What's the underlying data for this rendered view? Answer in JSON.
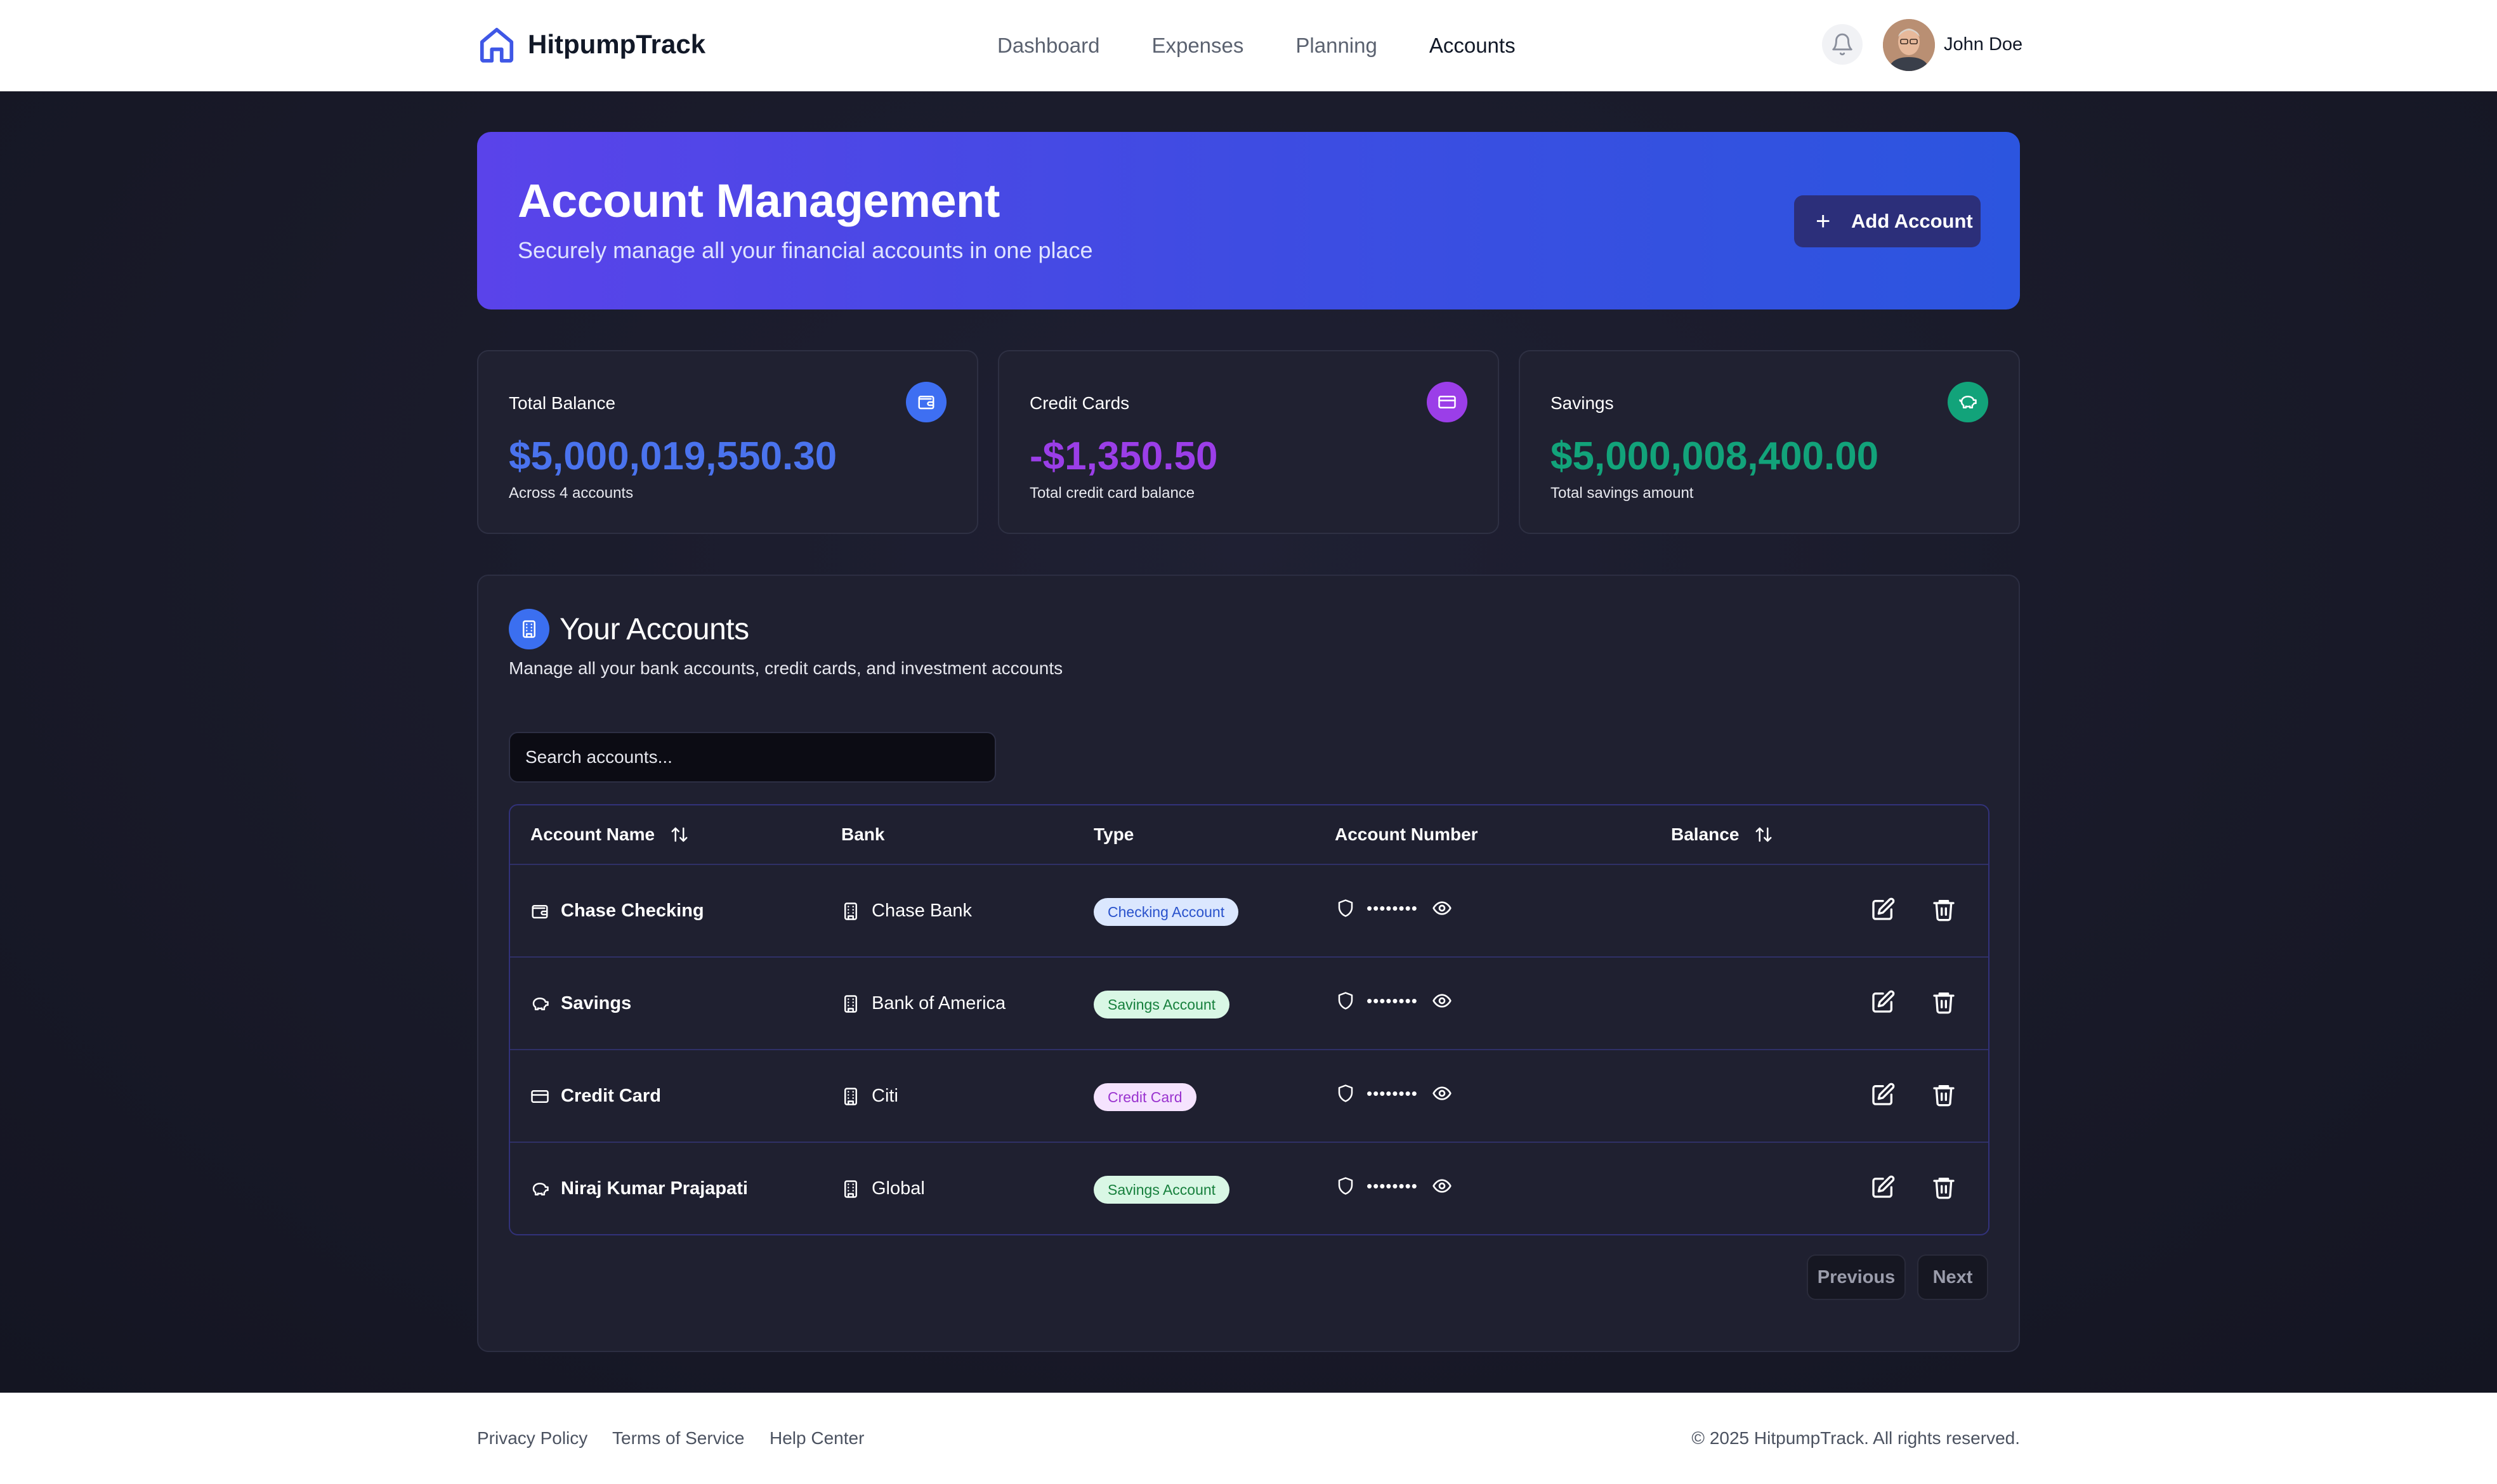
{
  "app": {
    "name": "HitpumpTrack"
  },
  "nav": [
    {
      "label": "Dashboard",
      "active": false
    },
    {
      "label": "Expenses",
      "active": false
    },
    {
      "label": "Planning",
      "active": false
    },
    {
      "label": "Accounts",
      "active": true
    }
  ],
  "user": {
    "name": "John Doe",
    "avatar_icon": "user-avatar"
  },
  "hero": {
    "title": "Account Management",
    "subtitle": "Securely manage all your financial accounts in one place",
    "add_button": "Add Account"
  },
  "stats": {
    "total_balance": {
      "title": "Total Balance",
      "value": "$5,000,019,550.30",
      "sub": "Across 4 accounts",
      "icon": "wallet-icon",
      "color": "#3e6ff2"
    },
    "credit_cards": {
      "title": "Credit Cards",
      "value": "-$1,350.50",
      "sub": "Total credit card balance",
      "icon": "credit-card-icon",
      "color": "#9b3ee8"
    },
    "savings": {
      "title": "Savings",
      "value": "$5,000,008,400.00",
      "sub": "Total savings amount",
      "icon": "piggy-bank-icon",
      "color": "#12a37a"
    }
  },
  "accounts_panel": {
    "title": "Your Accounts",
    "description": "Manage all your bank accounts, credit cards, and investment accounts",
    "search_placeholder": "Search accounts...",
    "columns": [
      "Account Name",
      "Bank",
      "Type",
      "Account Number",
      "Balance"
    ],
    "rows": [
      {
        "name": "Chase Checking",
        "bank": "Chase Bank",
        "type": "Checking Account",
        "type_kind": "checking",
        "account_number": "••••••••",
        "balance": ""
      },
      {
        "name": "Savings",
        "bank": "Bank of America",
        "type": "Savings Account",
        "type_kind": "savings",
        "account_number": "••••••••",
        "balance": ""
      },
      {
        "name": "Credit Card",
        "bank": "Citi",
        "type": "Credit Card",
        "type_kind": "credit",
        "account_number": "••••••••",
        "balance": ""
      },
      {
        "name": "Niraj Kumar Prajapati",
        "bank": "Global",
        "type": "Savings Account",
        "type_kind": "savings",
        "account_number": "••••••••",
        "balance": ""
      }
    ],
    "pagination": {
      "previous": "Previous",
      "next": "Next"
    }
  },
  "footer": {
    "links": [
      "Privacy Policy",
      "Terms of Service",
      "Help Center"
    ],
    "copyright": "© 2025 HitpumpTrack. All rights reserved."
  },
  "colors": {
    "checking_badge_bg": "#dbe7fe",
    "checking_badge_fg": "#2952cc",
    "savings_badge_bg": "#d9f7e5",
    "savings_badge_fg": "#17803d",
    "credit_badge_bg": "#f5e3fe",
    "credit_badge_fg": "#9a33cf"
  }
}
